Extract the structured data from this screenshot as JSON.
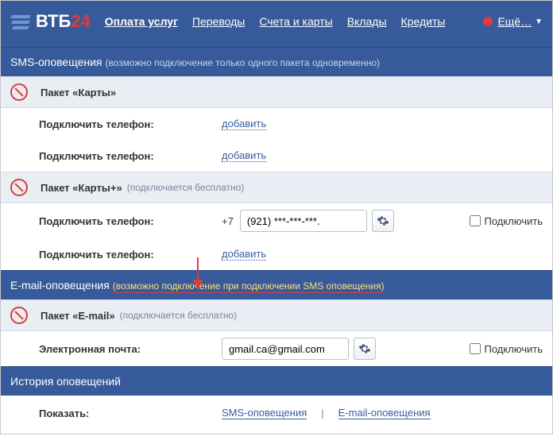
{
  "logo": {
    "text": "ВТБ",
    "suffix": "24"
  },
  "nav": {
    "payments": "Оплата услуг",
    "transfers": "Переводы",
    "accounts": "Счета и карты",
    "deposits": "Вклады",
    "credits": "Кредиты",
    "more": "Ещё…"
  },
  "sms": {
    "title": "SMS-оповещения",
    "note": "(возможно подключение только одного пакета одновременно)",
    "pkg_cards": {
      "name": "Пакет «Карты»",
      "phone_label": "Подключить телефон:",
      "add_link": "добавить"
    },
    "pkg_cards_plus": {
      "name": "Пакет «Карты+»",
      "note": "(подключается бесплатно)",
      "phone_label": "Подключить телефон:",
      "prefix": "+7",
      "phone_value": "(921) ***-***-***.",
      "connect": "Подключить",
      "add_link": "добавить"
    }
  },
  "email": {
    "title": "E-mail-оповещения",
    "note": "(возможно подключение при подключении SMS оповещения)",
    "pkg": {
      "name": "Пакет «E-mail»",
      "note": "(подключается бесплатно)",
      "label": "Электронная почта:",
      "value": "gmail.ca@gmail.com",
      "connect": "Подключить"
    }
  },
  "history": {
    "title": "История оповещений",
    "show": "Показать:",
    "sms_link": "SMS-оповещения",
    "email_link": "E-mail-оповещения"
  }
}
